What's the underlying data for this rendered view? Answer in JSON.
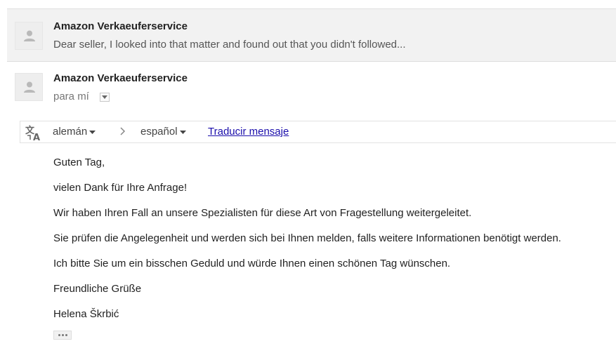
{
  "collapsed_message": {
    "sender": "Amazon Verkaeuferservice",
    "snippet": "Dear seller, I looked into that matter and found out that you didn't followed..."
  },
  "open_message": {
    "sender": "Amazon Verkaeuferservice",
    "recipient_line": "para mí"
  },
  "translate_bar": {
    "from_language": "alemán",
    "to_language": "español",
    "translate_link": "Traducir mensaje"
  },
  "body": {
    "lines": [
      "Guten Tag,",
      "vielen Dank für Ihre Anfrage!",
      "Wir haben Ihren Fall an unsere Spezialisten für diese Art von Fragestellung weitergeleitet.",
      "Sie prüfen die Angelegenheit und werden sich bei Ihnen melden, falls weitere Informationen benötigt werden.",
      "Ich bitte Sie um ein bisschen Geduld und würde Ihnen einen schönen Tag wünschen.",
      "Freundliche Grüße",
      "Helena Škrbić"
    ]
  },
  "icons": {
    "avatar": "person-icon",
    "translate": "translate-icon",
    "details": "chevron-down-icon",
    "arrow": "chevron-right-icon",
    "trimmed": "ellipsis-icon"
  },
  "colors": {
    "link": "#1a0dab",
    "collapsed_bg": "#f2f2f2"
  }
}
